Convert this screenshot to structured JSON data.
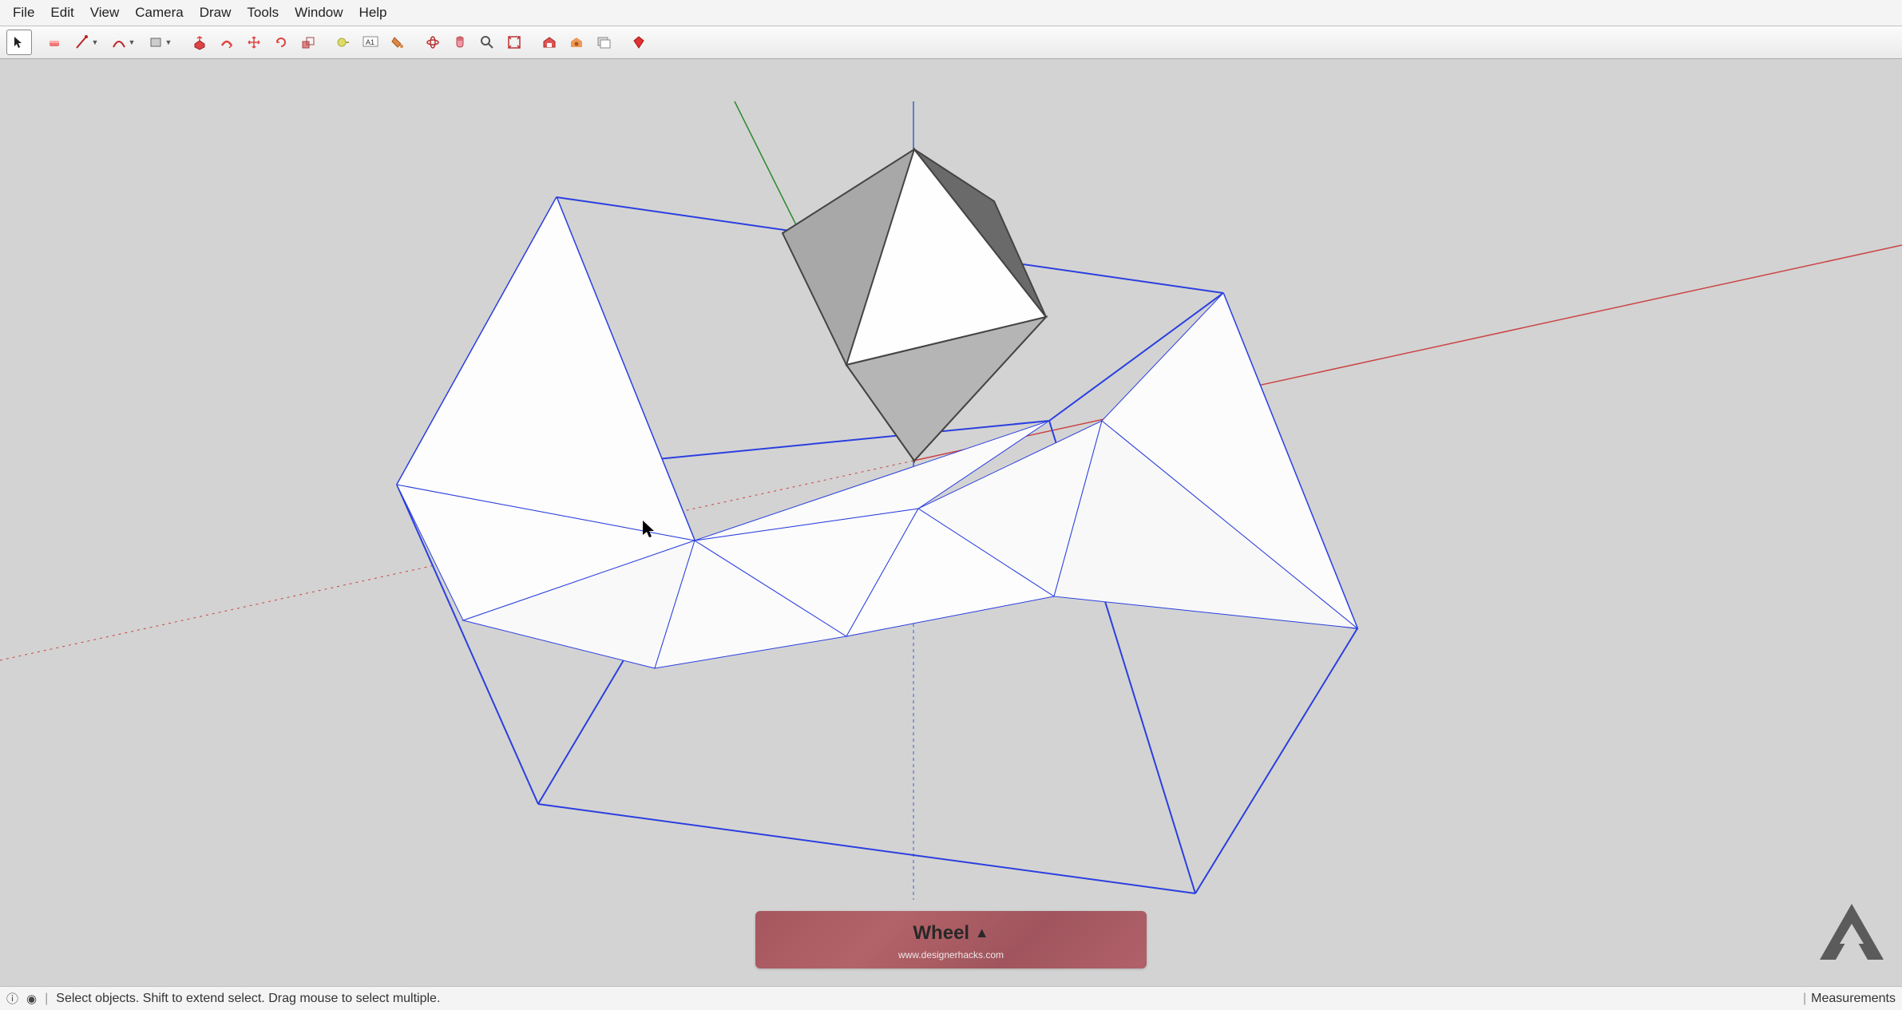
{
  "menu": [
    "File",
    "Edit",
    "View",
    "Camera",
    "Draw",
    "Tools",
    "Window",
    "Help"
  ],
  "status": {
    "hint": "Select objects. Shift to extend select. Drag mouse to select multiple.",
    "measurements_label": "Measurements"
  },
  "banner": {
    "title": "Wheel",
    "glyph": "▲",
    "subtitle": "www.designerhacks.com"
  },
  "tools": {
    "select": "Select",
    "eraser": "Eraser",
    "line": "Line",
    "arc": "Arc",
    "shape": "Shape",
    "pushpull": "Push/Pull",
    "followme": "Follow Me",
    "move": "Move",
    "rotate": "Rotate",
    "scale": "Scale",
    "tape": "Tape Measure",
    "text": "Text",
    "paint": "Paint Bucket",
    "orbit": "Orbit",
    "pan": "Pan",
    "zoom": "Zoom",
    "zoomextents": "Zoom Extents",
    "warehouse": "3D Warehouse",
    "extensions": "Extension Warehouse",
    "layers": "Layers",
    "ruby": "Ruby Console"
  }
}
